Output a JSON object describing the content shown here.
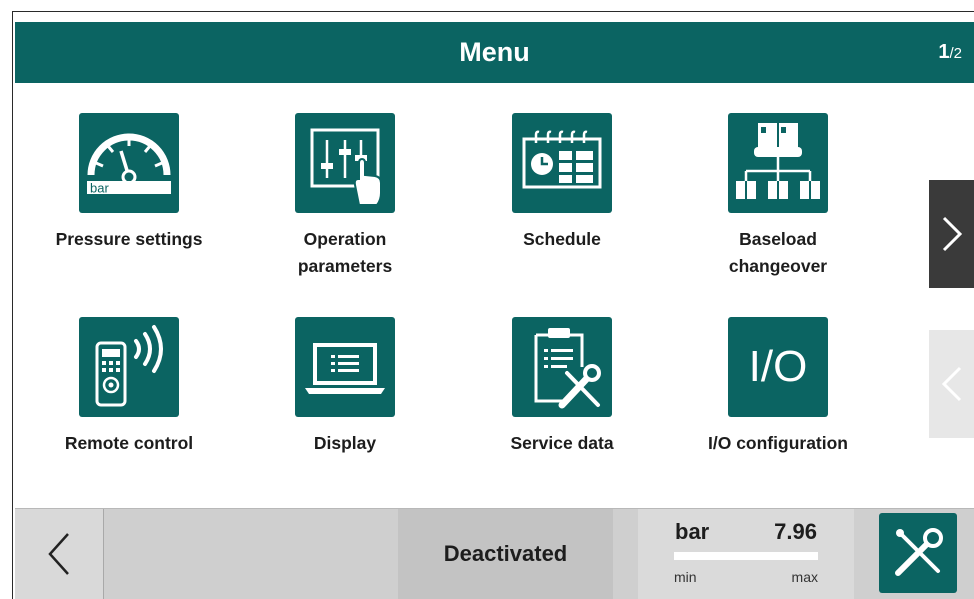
{
  "header": {
    "title": "Menu",
    "page_current": "1",
    "page_total": "/2"
  },
  "tiles": [
    {
      "label_lines": [
        "Pressure settings"
      ],
      "icon_text": "bar",
      "icon": "pressure-gauge-icon"
    },
    {
      "label_lines": [
        "Operation",
        "parameters"
      ],
      "icon": "sliders-touch-icon"
    },
    {
      "label_lines": [
        "Schedule"
      ],
      "icon": "calendar-clock-icon"
    },
    {
      "label_lines": [
        "Baseload",
        "changeover"
      ],
      "icon": "compressor-network-icon"
    },
    {
      "label_lines": [
        "Remote control"
      ],
      "icon": "remote-signal-icon"
    },
    {
      "label_lines": [
        "Display"
      ],
      "icon": "laptop-display-icon"
    },
    {
      "label_lines": [
        "Service data"
      ],
      "icon": "clipboard-tools-icon"
    },
    {
      "label_lines": [
        "I/O configuration"
      ],
      "icon_text": "I/O",
      "icon": "io-text-icon"
    }
  ],
  "status": {
    "text": "Deactivated"
  },
  "gauge": {
    "unit": "bar",
    "value": "7.96",
    "min_label": "min",
    "max_label": "max"
  },
  "colors": {
    "primary": "#0b6462",
    "nav_dark": "#3a3a3a",
    "footer": "#cfcfcf"
  }
}
